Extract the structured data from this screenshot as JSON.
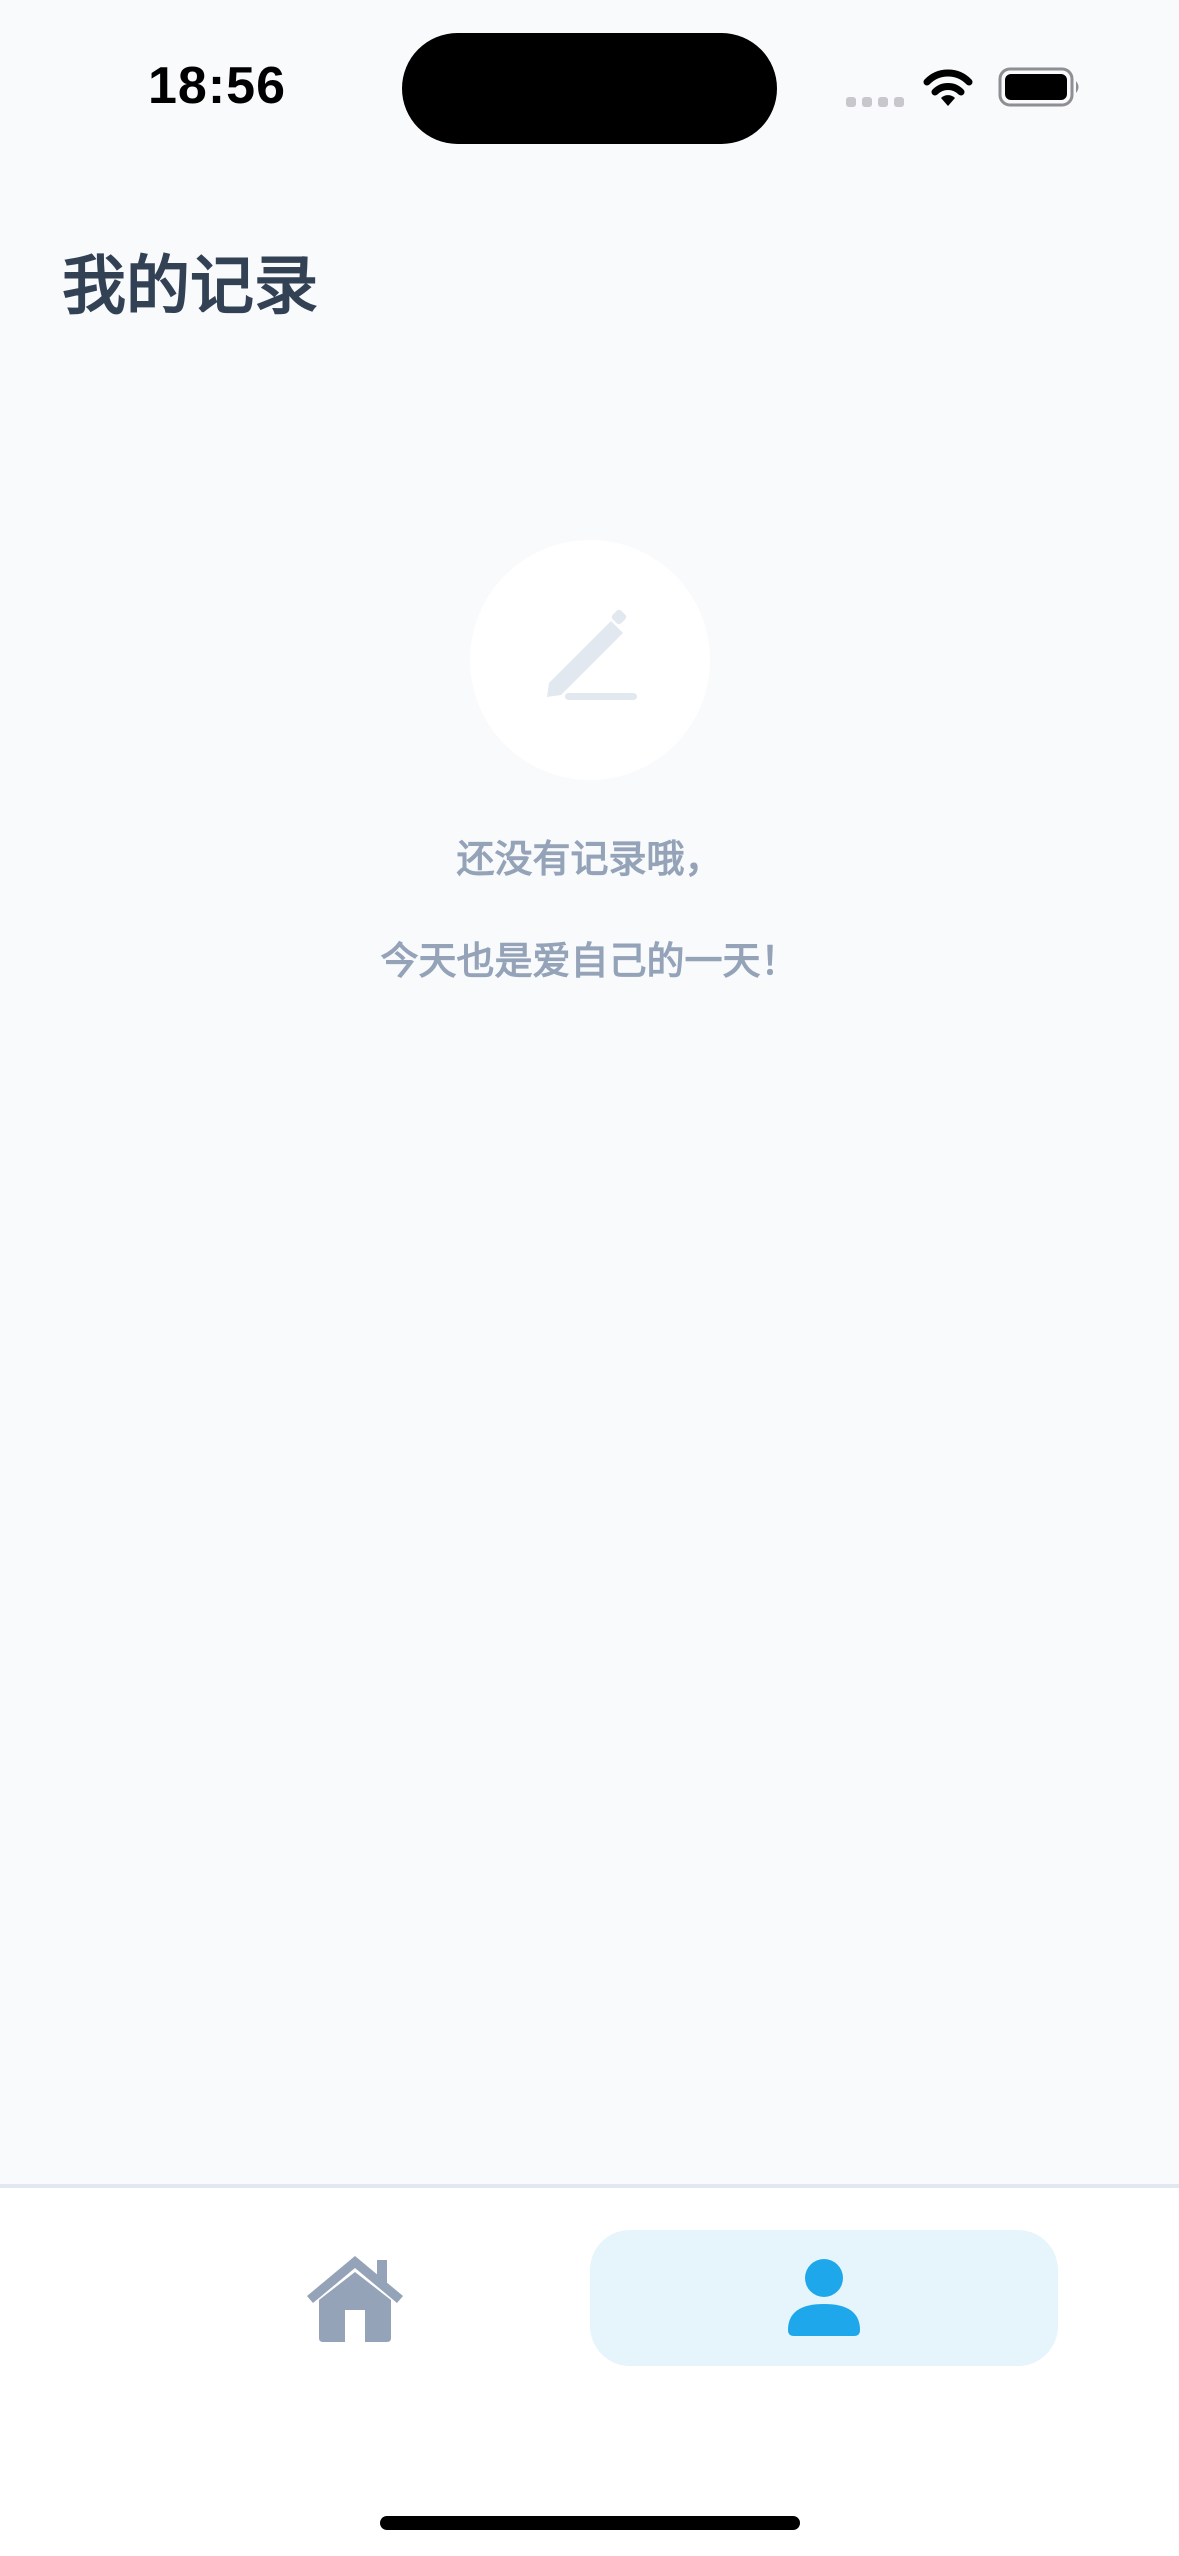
{
  "status_bar": {
    "time": "18:56"
  },
  "header": {
    "title": "我的记录"
  },
  "empty_state": {
    "icon": "pencil-icon",
    "line1": "还没有记录哦，",
    "line2": "今天也是爱自己的一天！"
  },
  "tab_bar": {
    "tabs": [
      {
        "icon": "home-icon",
        "selected": false
      },
      {
        "icon": "person-icon",
        "selected": true
      }
    ]
  },
  "colors": {
    "background": "#f8fafc",
    "title": "#334155",
    "muted_text": "#94a3b8",
    "accent": "#1ea7ea",
    "accent_bg": "#e6f4fc",
    "inactive_icon": "#94a3b8"
  }
}
